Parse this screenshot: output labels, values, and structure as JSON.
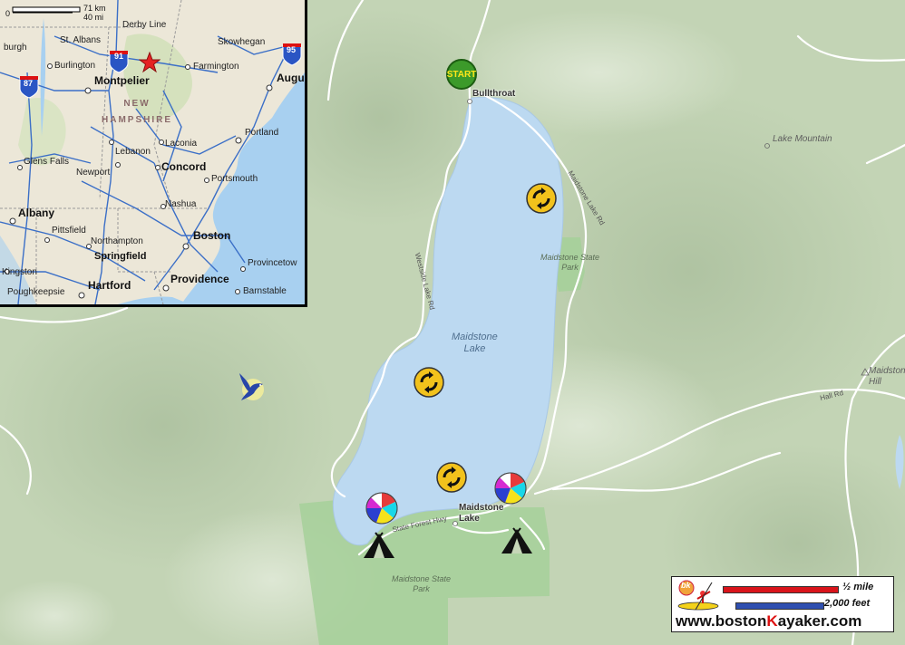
{
  "map": {
    "lake_name": "Maidstone\nLake",
    "places": {
      "bullthroat": "Bullthroat",
      "maidstone_lake_village": "Maidstone\nLake",
      "lake_mountain": "Lake Mountain",
      "maidstone_hill": "Maidstone\nHill"
    },
    "parks": {
      "park_east": "Maidstone State\nPark",
      "park_south": "Maidstone State\nPark"
    },
    "roads": {
      "maidstone_lake_rd": "Maidstone Lake Rd",
      "westside_lake_rd": "Westside Lake Rd",
      "state_forest_hwy": "State Forest Hwy",
      "hall_rd": "Hall Rd"
    },
    "colors": {
      "terrain": "#c6d6b8",
      "water": "#b9d8f2",
      "park": "#a3cf96",
      "roads": "#ffffff"
    }
  },
  "inset": {
    "scale": {
      "zero": "0",
      "km": "71 km",
      "mi": "40 mi"
    },
    "state_label": "NEW\nHAMPSHIRE",
    "cities": {
      "derby_line": "Derby Line",
      "st_albans": "St. Albans",
      "burgh": "burgh",
      "skowhegan": "Skowhegan",
      "burlington": "Burlington",
      "farmington": "Farmington",
      "montpelier": "Montpelier",
      "augusta": "Augu",
      "portland": "Portland",
      "laconia": "Laconia",
      "lebanon": "Lebanon",
      "glens_falls": "Glens Falls",
      "concord": "Concord",
      "newport": "Newport",
      "portsmouth": "Portsmouth",
      "nashua": "Nashua",
      "albany": "Albany",
      "pittsfield": "Pittsfield",
      "boston": "Boston",
      "northampton": "Northampton",
      "springfield": "Springfield",
      "provincetown": "Provincetow",
      "kingston": "Kingston",
      "providence": "Providence",
      "hartford": "Hartford",
      "poughkeepsie": "Poughkeepsie",
      "barnstable": "Barnstable"
    },
    "shields": {
      "i91": "91",
      "i95": "95",
      "i87": "87"
    }
  },
  "markers": {
    "start_label": "START",
    "icons": [
      "start-icon",
      "loop-icon",
      "beach-ball-icon",
      "tent-icon",
      "bird-icon",
      "red-star-icon"
    ]
  },
  "legend": {
    "half_mile": "½ mile",
    "feet": "2,000 feet",
    "logo_text": "bk",
    "url_prefix": "www.boston",
    "url_k": "K",
    "url_suffix": "ayaker.com",
    "bar_red": "#d9141b",
    "bar_blue": "#2f4fb0"
  }
}
